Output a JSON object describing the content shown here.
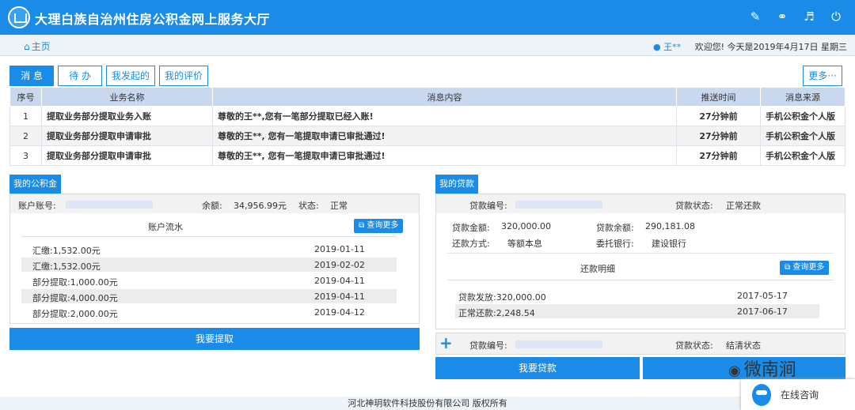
{
  "header": {
    "title": "大理白族自治州住房公积金网上服务大厅",
    "icons": [
      "edit-icon",
      "key-icon",
      "speaker-icon",
      "power-icon"
    ]
  },
  "nav": {
    "home": "主页",
    "user": "王**",
    "welcome": "欢迎您! 今天是2019年4月17日 星期三"
  },
  "tabs": {
    "messages": "消 息",
    "todo": "待 办",
    "initiated": "我发起的",
    "reviews": "我的评价",
    "more": "更多···"
  },
  "msg_table": {
    "headers": [
      "序号",
      "业务名称",
      "消息内容",
      "推送时间",
      "消息来源"
    ],
    "rows": [
      [
        "1",
        "提取业务部分提取业务入账",
        "尊敬的王**,您有一笔部分提取已经入账!",
        "27分钟前",
        "手机公积金个人版"
      ],
      [
        "2",
        "提取业务部分提取申请审批",
        "尊敬的王**, 您有一笔提取申请已审批通过!",
        "27分钟前",
        "手机公积金个人版"
      ],
      [
        "3",
        "提取业务部分提取申请审批",
        "尊敬的王**, 您有一笔提取申请已审批通过!",
        "27分钟前",
        "手机公积金个人版"
      ]
    ]
  },
  "fund": {
    "title": "我的公积金",
    "account_label": "账户账号:",
    "balance_label": "余额:",
    "balance": "34,956.99元",
    "status_label": "状态:",
    "status": "正常",
    "flow_title": "账户流水",
    "query_more": "查询更多",
    "flows": [
      [
        "汇缴:1,532.00元",
        "2019-01-11"
      ],
      [
        "汇缴:1,532.00元",
        "2019-02-02"
      ],
      [
        "部分提取:1,000.00元",
        "2019-04-11"
      ],
      [
        "部分提取:4,000.00元",
        "2019-04-11"
      ],
      [
        "部分提取:2,000.00元",
        "2019-04-12"
      ]
    ],
    "withdraw_button": "我要提取"
  },
  "loan": {
    "title": "我的贷款",
    "loan_no_label": "贷款编号:",
    "status_label": "贷款状态:",
    "status": "正常还款",
    "amount_label": "贷款金额:",
    "amount": "320,000.00",
    "remaining_label": "贷款余额:",
    "remaining": "290,181.08",
    "method_label": "还款方式:",
    "method": "等额本息",
    "bank_label": "委托银行:",
    "bank": "建设银行",
    "detail_title": "还款明细",
    "query_more": "查询更多",
    "details": [
      [
        "贷款发放:320,000.00",
        "2017-05-17"
      ],
      [
        "正常还款:2,248.54",
        "2017-06-17"
      ]
    ],
    "second_status": "结清状态",
    "loan_button": "我要贷款"
  },
  "footer": "河北神玥软件科技股份有限公司 版权所有",
  "watermark": "微南涧",
  "chat": "在线咨询",
  "colors": {
    "primary": "#1a8be6",
    "header_row": "#c9d8ee"
  }
}
